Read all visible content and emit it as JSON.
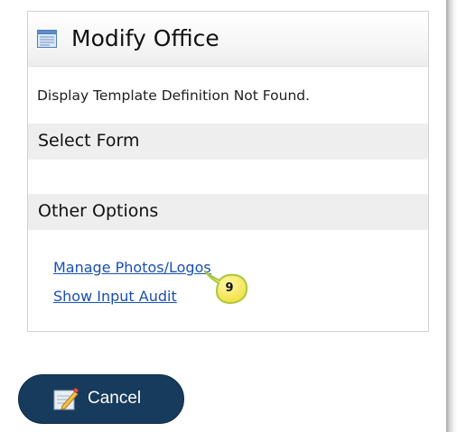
{
  "panel": {
    "title": "Modify Office",
    "message": "Display Template Definition Not Found.",
    "sections": {
      "select_form": "Select Form",
      "other_options": "Other Options"
    },
    "links": {
      "manage_photos": "Manage Photos/Logos",
      "show_input_audit": "Show Input Audit"
    },
    "callout_number": "9"
  },
  "actions": {
    "cancel_label": "Cancel"
  },
  "icons": {
    "header_icon": "form-icon",
    "cancel_icon": "edit-cancel-icon"
  },
  "colors": {
    "link": "#1a4fb0",
    "button_bg": "#173b5c",
    "section_bg": "#eeeeee",
    "callout_fill": "#f5e85a",
    "callout_border": "#9ec33d"
  }
}
